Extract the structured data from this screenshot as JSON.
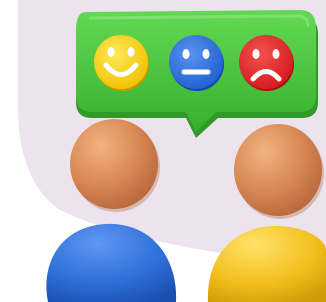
{
  "scene": {
    "background": "#ffffff",
    "backdrop_color": "#ece3ee",
    "bubble_color": "#4cc93f",
    "faces": [
      {
        "icon": "happy-face-icon",
        "mood": "happy",
        "color": "#f7d21e"
      },
      {
        "icon": "neutral-face-icon",
        "mood": "neutral",
        "color": "#2f6fe0"
      },
      {
        "icon": "sad-face-icon",
        "mood": "sad",
        "color": "#e6262b"
      }
    ],
    "people": [
      {
        "name": "person-left",
        "head_color": "#d88a55",
        "body_color": "#2e6fd8"
      },
      {
        "name": "person-right",
        "head_color": "#d88a55",
        "body_color": "#f3bf1c"
      }
    ]
  }
}
